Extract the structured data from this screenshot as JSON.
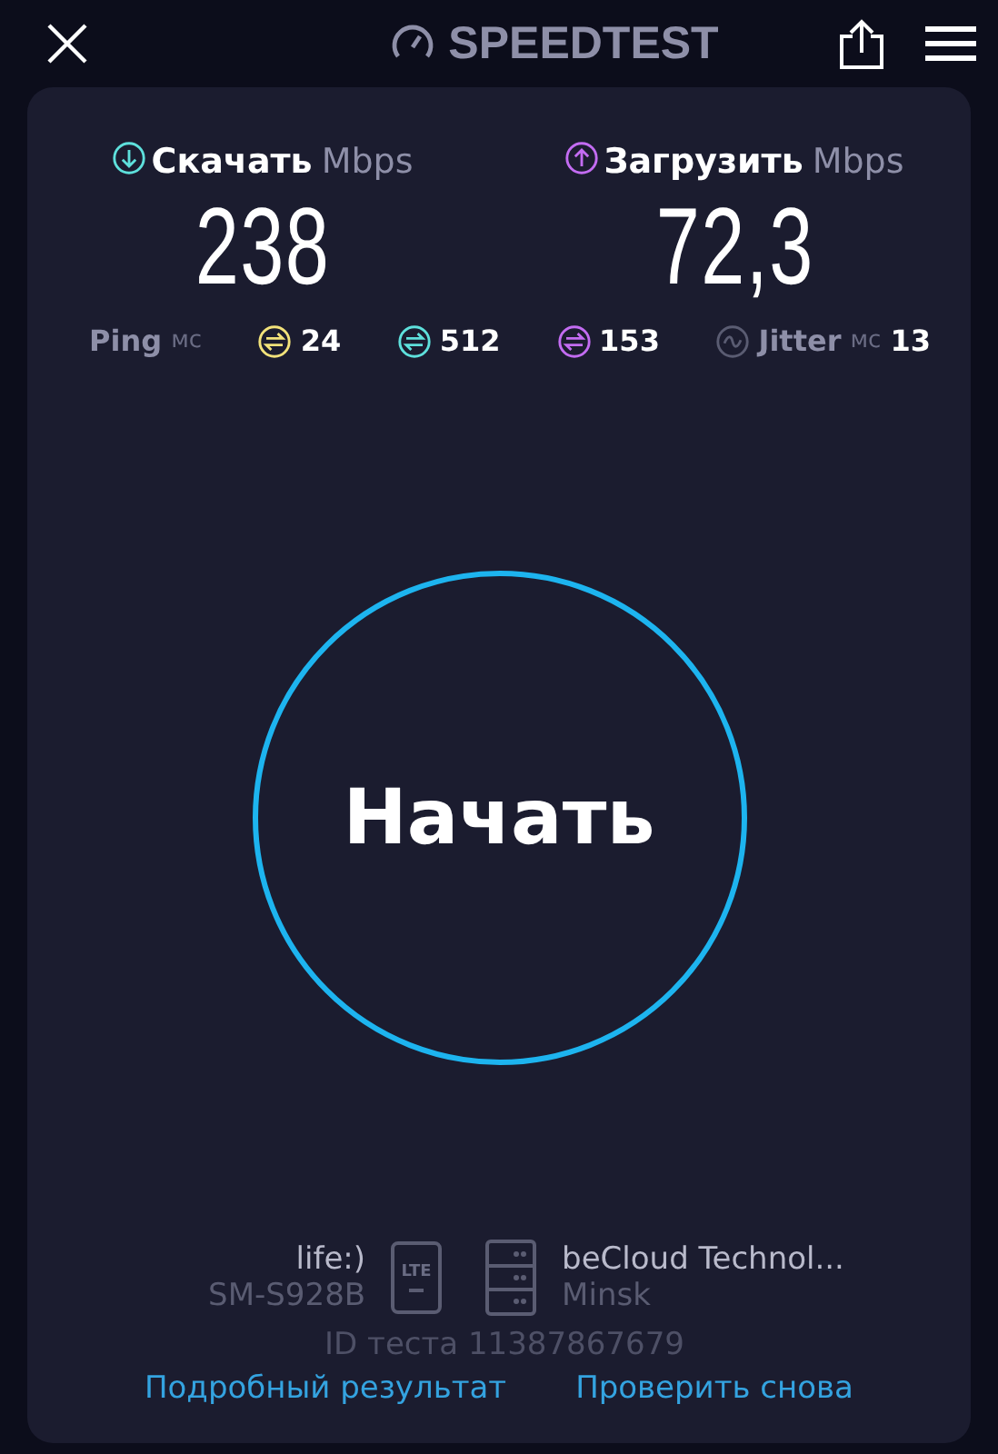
{
  "header": {
    "title": "SPEEDTEST"
  },
  "results": [
    {
      "kind": "download",
      "label": "Скачать",
      "unit": "Mbps",
      "value": "238",
      "color": "#5ee0dc"
    },
    {
      "kind": "upload",
      "label": "Загрузить",
      "unit": "Mbps",
      "value": "72,3",
      "color": "#c36cf2"
    }
  ],
  "ping": {
    "label": "Ping",
    "unit": "мс",
    "values": [
      {
        "value": "24",
        "color": "#f2e27a"
      },
      {
        "value": "512",
        "color": "#5ee0dc"
      },
      {
        "value": "153",
        "color": "#c36cf2"
      }
    ]
  },
  "jitter": {
    "label": "Jitter",
    "unit": "мс",
    "value": "13"
  },
  "start_button": {
    "label": "Начать"
  },
  "provider": {
    "name": "life:)",
    "device": "SM-S928B",
    "network": "LTE"
  },
  "server": {
    "name": "beCloud Technol...",
    "city": "Minsk"
  },
  "test_id": "ID теста 11387867679",
  "links": [
    "Подробный результат",
    "Проверить снова"
  ]
}
